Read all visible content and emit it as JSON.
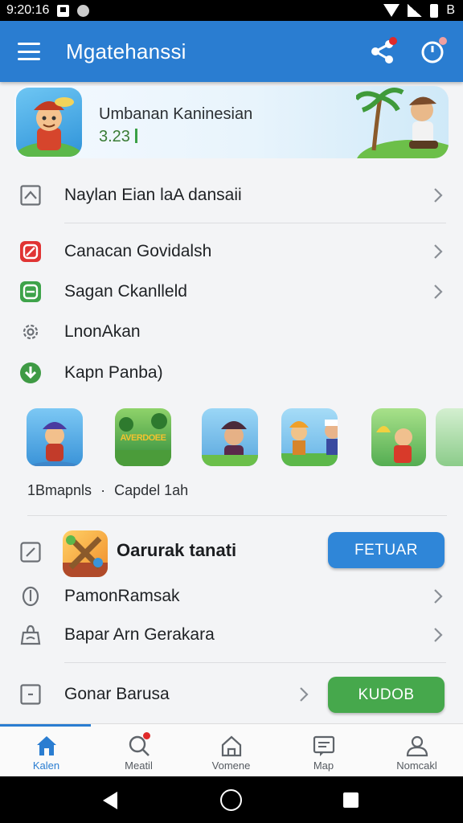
{
  "status_bar": {
    "time": "9:20:16",
    "right_text": "B"
  },
  "app_bar": {
    "title": "Mgatehanssi"
  },
  "banner": {
    "title": "Umbanan Kaninesian",
    "value": "3.23"
  },
  "menu_top": [
    {
      "label": "Naylan Eian laA dansaii",
      "icon": "image-icon"
    }
  ],
  "menu_mid": [
    {
      "label": "Canacan Govidalsh",
      "icon": "red-app-icon",
      "chevron": true
    },
    {
      "label": "Sagan Ckanlleld",
      "icon": "green-app-icon",
      "chevron": true
    },
    {
      "label": "LnonAkan",
      "icon": "gear-icon",
      "chevron": false
    },
    {
      "label": "Kapn Panba)",
      "icon": "download-icon",
      "chevron": false
    }
  ],
  "game_strip": {
    "tiles": [
      "game-tile-pirate",
      "game-tile-adventure",
      "game-tile-hat",
      "game-tile-duo",
      "game-tile-banana",
      "game-tile-partial"
    ],
    "banner_text": "AVERDOEE",
    "caption_left": "1Bmapnls",
    "caption_separator": "·",
    "caption_right": "Capdel 1ah"
  },
  "featured": {
    "title": "Oarurak tanati",
    "button_label": "FETUAR",
    "icon": "checkbox-edit-icon"
  },
  "menu_lower": [
    {
      "label": "PamonRamsak",
      "icon": "location-icon",
      "chevron": true
    },
    {
      "label": "Bapar Arn Gerakara",
      "icon": "bag-icon",
      "chevron": true
    }
  ],
  "last_row": {
    "label": "Gonar Barusa",
    "icon": "square-minus-icon",
    "button_label": "KUDOB"
  },
  "bottom_nav": [
    {
      "label": "Kalen",
      "icon": "home-icon",
      "active": true
    },
    {
      "label": "Meatil",
      "icon": "search-icon",
      "active": false,
      "badge": true
    },
    {
      "label": "Vomene",
      "icon": "house-outline-icon",
      "active": false
    },
    {
      "label": "Map",
      "icon": "message-icon",
      "active": false
    },
    {
      "label": "Nomcakl",
      "icon": "person-icon",
      "active": false
    }
  ],
  "colors": {
    "primary": "#2a7dd1",
    "green": "#46a84c",
    "badge_red": "#e02a2a"
  }
}
